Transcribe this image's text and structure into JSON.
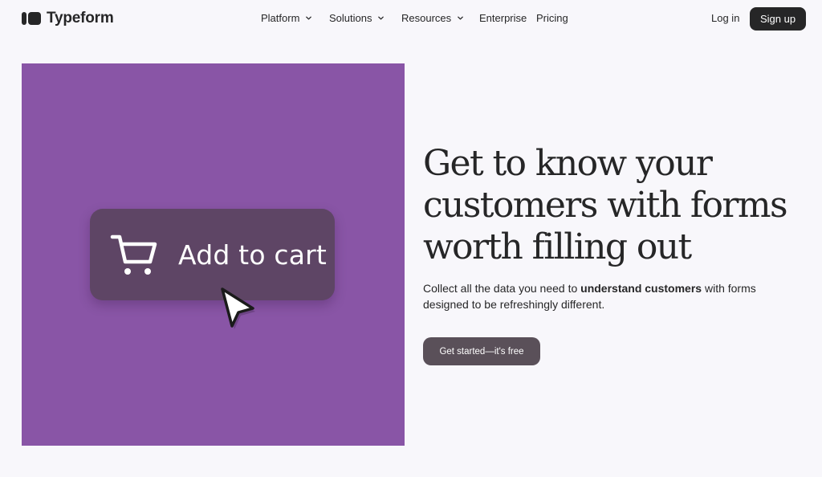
{
  "brand": {
    "name": "Typeform",
    "logo_icon": "typeform-logo-icon"
  },
  "nav": {
    "items": [
      {
        "label": "Platform",
        "has_dropdown": true
      },
      {
        "label": "Solutions",
        "has_dropdown": true
      },
      {
        "label": "Resources",
        "has_dropdown": true
      },
      {
        "label": "Enterprise",
        "has_dropdown": false
      },
      {
        "label": "Pricing",
        "has_dropdown": false
      }
    ],
    "login_label": "Log in",
    "signup_label": "Sign up"
  },
  "hero": {
    "panel_color": "#8955a6",
    "card_label": "Add to cart",
    "card_icon": "shopping-cart-icon",
    "cursor_icon": "pointer-cursor-icon",
    "headline_lines": [
      "Get to know your",
      "customers with forms",
      "worth filling out"
    ],
    "subtext_before": "Collect all the data you need to ",
    "subtext_bold": "understand customers",
    "subtext_after": " with forms designed to be refreshingly different.",
    "cta_label": "Get started—it's free"
  },
  "colors": {
    "dark": "#262627",
    "page_bg": "#f8f7fb",
    "cta_bg": "#5a5059"
  }
}
